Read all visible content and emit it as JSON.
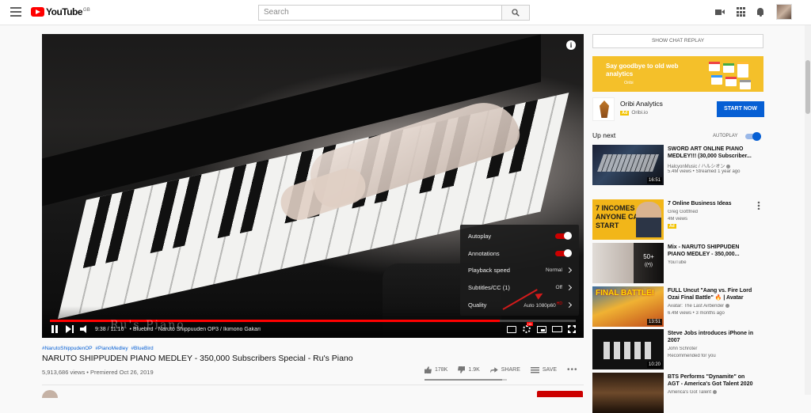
{
  "header": {
    "logo_text": "YouTube",
    "region": "GB",
    "search_placeholder": "Search"
  },
  "player": {
    "time": "9:38 / 11:16",
    "chapter": "• Bluebird - Naruto Shippuuden OP3 / Ikimono Gakari",
    "watermark": "Ru's Piano",
    "progress": 0.855,
    "settings": {
      "autoplay": "Autoplay",
      "annotations": "Annotations",
      "playback_speed": "Playback speed",
      "playback_speed_value": "Normal",
      "subtitles": "Subtitles/CC (1)",
      "subtitles_value": "Off",
      "quality": "Quality",
      "quality_value": "Auto 1080p60",
      "quality_badge": "HD"
    }
  },
  "video": {
    "hashtags": [
      "#NarutoShippudenOP",
      "#PianoMedley",
      "#BlueBird"
    ],
    "title": "NARUTO SHIPPUDEN PIANO MEDLEY - 350,000 Subscribers Special - Ru's Piano",
    "views": "5,913,686 views • Premiered Oct 26, 2019",
    "likes": "178K",
    "dislikes": "1.9K",
    "share": "SHARE",
    "save": "SAVE",
    "like_ratio": 0.94
  },
  "sidebar": {
    "chat_replay": "SHOW CHAT REPLAY",
    "ad_banner": {
      "headline": "Say goodbye to old web analytics",
      "brand": "Oribi"
    },
    "ad": {
      "name": "Oribi Analytics",
      "badge": "Ad",
      "domain": "Oribi.io",
      "cta": "START NOW"
    },
    "up_next": "Up next",
    "autoplay": "AUTOPLAY",
    "recommendations": [
      {
        "title": "SWORD ART ONLINE PIANO MEDLEY!!! (30,000 Subscriber...",
        "line1": "HalcyonMusic / ハルシオン",
        "line2": "5.4M views • Streamed 1 year ago",
        "duration": "16:51"
      },
      {
        "title": "7 Online Business Ideas",
        "line1": "Greg Gottfried",
        "line2": "4M views",
        "ad_label": "Ad",
        "thumb_text": "7 INCOMES ANYONE CAN START"
      },
      {
        "title": "Mix - NARUTO SHIPPUDEN PIANO MEDLEY - 350,000...",
        "line1": "YouTube",
        "line2": "",
        "mix_count": "50+"
      },
      {
        "title": "FULL Uncut \"Aang vs. Fire Lord Ozai Final Battle\" 🔥 | Avatar",
        "line1": "Avatar: The Last Airbender",
        "line2": "6.4M views • 3 months ago",
        "duration": "13:51",
        "thumb_text": "FINAL BATTLE!"
      },
      {
        "title": "Steve Jobs introduces iPhone in 2007",
        "line1": "John Schroter",
        "line2": "Recommended for you",
        "duration": "10:20"
      },
      {
        "title": "BTS Performs \"Dynamite\" on AGT - America's Got Talent 2020",
        "line1": "America's Got Talent",
        "line2": ""
      }
    ]
  }
}
